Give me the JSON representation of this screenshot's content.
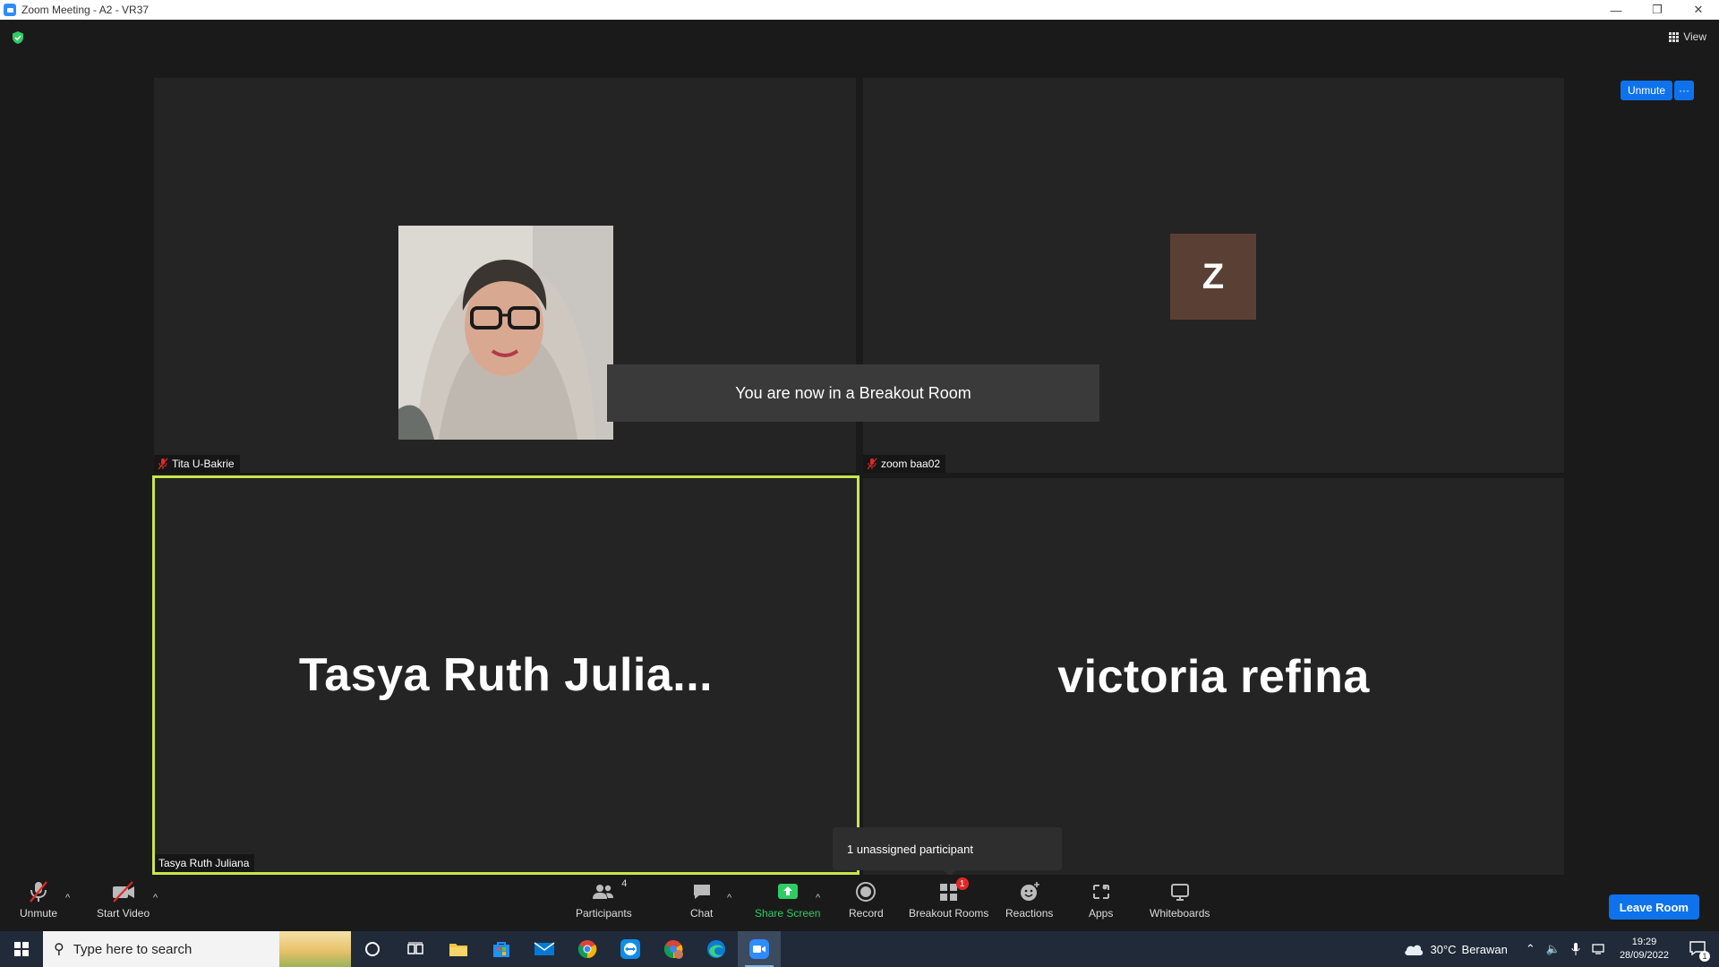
{
  "window": {
    "title": "Zoom Meeting - A2 - VR37",
    "minimize": "—",
    "restore": "❐",
    "close": "✕"
  },
  "meeting": {
    "view_label": "View",
    "toast": "You are now in a Breakout Room",
    "unassigned_popup": "1 unassigned participant",
    "top_unmute_label": "Unmute",
    "top_more_label": "···"
  },
  "participants": [
    {
      "name": "Tita U-Bakrie",
      "muted": true
    },
    {
      "name": "zoom baa02",
      "muted": true,
      "avatar_letter": "Z"
    },
    {
      "name": "Tasya Ruth Juliana",
      "display_name": "Tasya  Ruth  Julia...",
      "muted": false,
      "active_speaker": true
    },
    {
      "name": "victoria refina",
      "display_name": "victoria refina",
      "muted": false
    }
  ],
  "toolbar": {
    "unmute": "Unmute",
    "start_video": "Start Video",
    "participants": "Participants",
    "participants_count": "4",
    "chat": "Chat",
    "share_screen": "Share Screen",
    "record": "Record",
    "breakout_rooms": "Breakout Rooms",
    "breakout_badge": "1",
    "reactions": "Reactions",
    "apps": "Apps",
    "whiteboards": "Whiteboards",
    "leave": "Leave Room",
    "caret": "^"
  },
  "taskbar": {
    "search_placeholder": "Type here to search",
    "weather_temp": "30°C",
    "weather_text": "Berawan",
    "time": "19:29",
    "date": "28/09/2022",
    "notification_count": "1"
  },
  "colors": {
    "zoom_blue": "#0E72ED",
    "speaker_border": "#c8e64a",
    "share_green": "#2FCB63",
    "badge_red": "#E02828",
    "avatar_brown": "#5a4034"
  }
}
